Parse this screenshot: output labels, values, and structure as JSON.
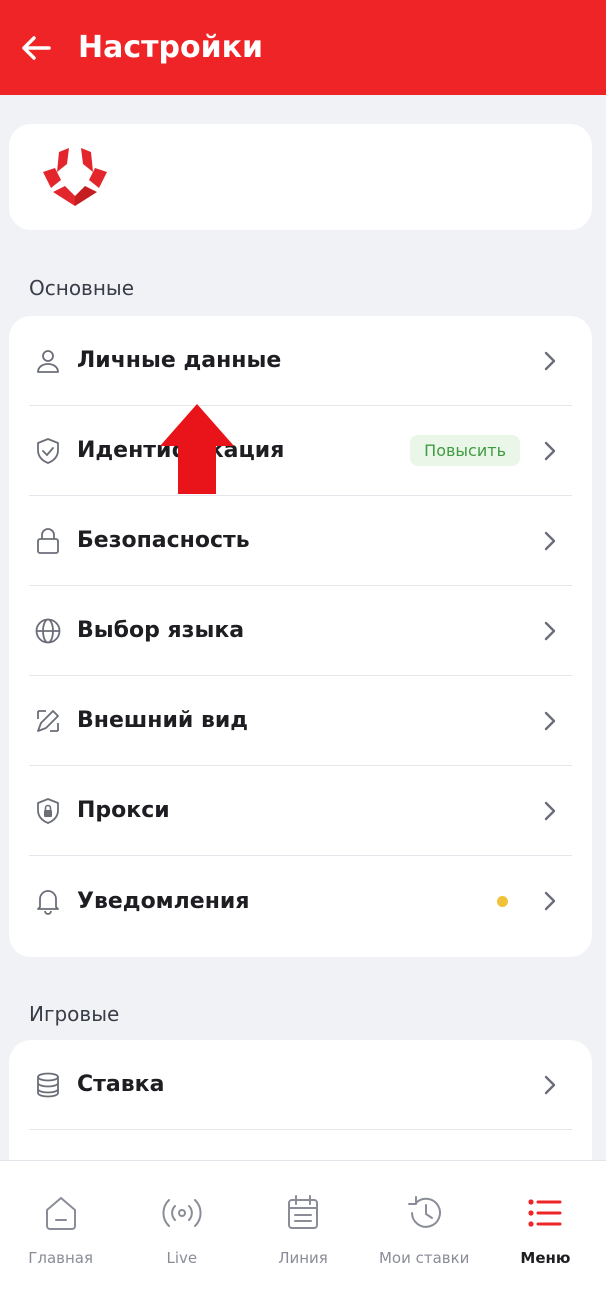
{
  "header": {
    "title": "Настройки"
  },
  "profile": {
    "name": ""
  },
  "sections": {
    "main": {
      "title": "Основные",
      "items": [
        {
          "label": "Личные данные",
          "icon": "user-icon"
        },
        {
          "label": "Идентификация",
          "icon": "shield-check-icon",
          "badge": "Повысить"
        },
        {
          "label": "Безопасность",
          "icon": "lock-icon"
        },
        {
          "label": "Выбор языка",
          "icon": "globe-icon"
        },
        {
          "label": "Внешний вид",
          "icon": "paint-icon"
        },
        {
          "label": "Прокси",
          "icon": "shield-lock-icon"
        },
        {
          "label": "Уведомления",
          "icon": "bell-icon"
        }
      ]
    },
    "game": {
      "title": "Игровые",
      "items": [
        {
          "label": "Ставка",
          "icon": "coins-icon"
        }
      ]
    }
  },
  "nav": {
    "items": [
      {
        "label": "Главная",
        "icon": "home-icon"
      },
      {
        "label": "Live",
        "icon": "broadcast-icon"
      },
      {
        "label": "Линия",
        "icon": "calendar-icon"
      },
      {
        "label": "Мои ставки",
        "icon": "history-icon"
      },
      {
        "label": "Меню",
        "icon": "menu-icon",
        "active": true
      }
    ]
  },
  "colors": {
    "brand": "#ef2426",
    "badge_text": "#3f9b42",
    "dot": "#f0c23a"
  }
}
